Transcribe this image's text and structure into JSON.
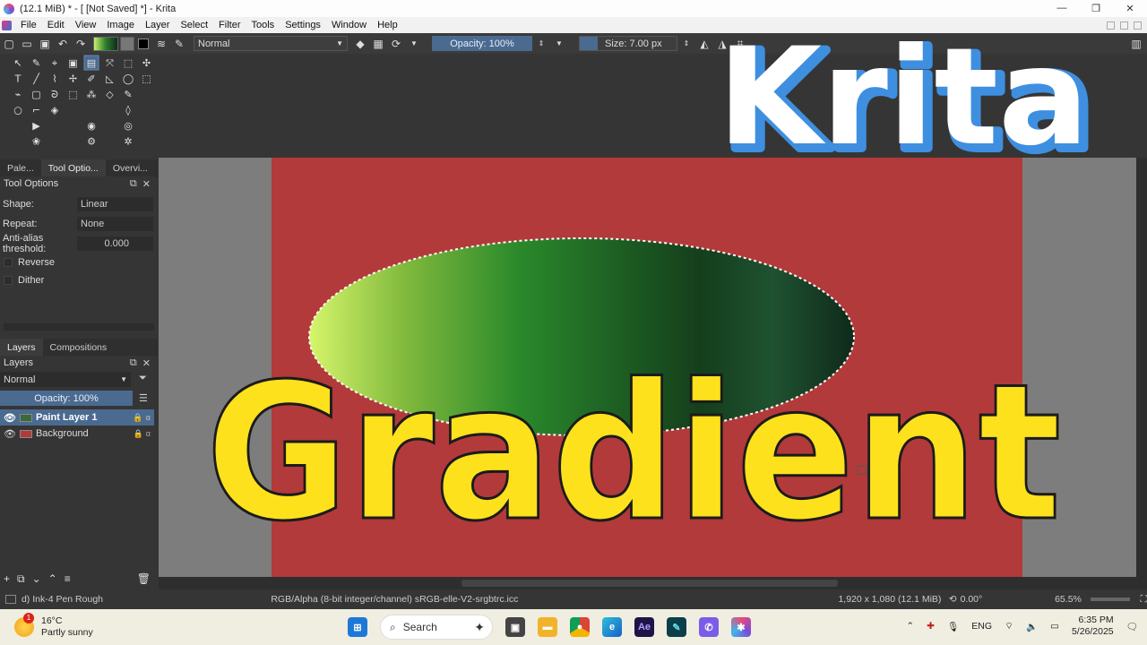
{
  "window": {
    "title": "(12.1 MiB)  * - [ [Not Saved]  *] - Krita",
    "controls": [
      "—",
      "❐",
      "✕"
    ]
  },
  "menu": [
    "File",
    "Edit",
    "View",
    "Image",
    "Layer",
    "Select",
    "Filter",
    "Tools",
    "Settings",
    "Window",
    "Help"
  ],
  "toolbar": {
    "blend_mode": "Normal",
    "opacity": "Opacity: 100%",
    "size": "Size: 7.00 px"
  },
  "overlay": {
    "logo_text": "Krita",
    "canvas_text": "Gradient",
    "colors": {
      "canvas_bg": "#b23a3a",
      "text_yellow": "#fde11d",
      "logo_blue": "#3f8fe0"
    }
  },
  "docker_tabs": [
    "Pale...",
    "Tool Optio...",
    "Overvi..."
  ],
  "tool_options": {
    "header": "Tool Options",
    "shape_label": "Shape:",
    "shape_value": "Linear",
    "repeat_label": "Repeat:",
    "repeat_value": "None",
    "antialias_label": "Anti-alias threshold:",
    "antialias_value": "0.000",
    "reverse_label": "Reverse",
    "dither_label": "Dither"
  },
  "layer_tabs": [
    "Layers",
    "Compositions"
  ],
  "layers_panel": {
    "header": "Layers",
    "blend_mode": "Normal",
    "opacity": "Opacity:  100%",
    "layers": [
      {
        "name": "Paint Layer 1",
        "selected": true
      },
      {
        "name": "Background",
        "selected": false
      }
    ]
  },
  "status": {
    "brush": "d) Ink-4 Pen Rough",
    "color_profile": "RGB/Alpha (8-bit integer/channel)  sRGB-elle-V2-srgbtrc.icc",
    "dimensions": "1,920 x 1,080 (12.1 MiB)",
    "rotation": "0.00°",
    "zoom": "65.5%"
  },
  "taskbar": {
    "temperature": "16°C",
    "weather": "Partly sunny",
    "weather_badge": "1",
    "search": "Search",
    "lang": "ENG",
    "time": "6:35 PM",
    "date": "5/26/2025"
  }
}
